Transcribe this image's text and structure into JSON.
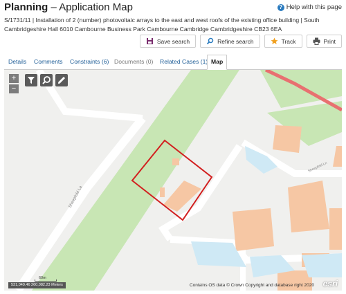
{
  "header": {
    "title_bold": "Planning",
    "title_rest": " – Application Map",
    "help_label": "Help with this page"
  },
  "description": "S/1731/11 | Installation of 2 (number) photovoltaic arrays to the east and west roofs of the existing office building | South Cambridgeshire Hall 6010 Cambourne Business Park Cambourne Cambridge Cambridgeshire CB23 6EA",
  "actions": {
    "save_search": "Save search",
    "refine_search": "Refine search",
    "track": "Track",
    "print": "Print"
  },
  "tabs": [
    {
      "label": "Details"
    },
    {
      "label": "Comments"
    },
    {
      "label": "Constraints (6)"
    },
    {
      "label": "Documents (0)"
    },
    {
      "label": "Related Cases (1)"
    },
    {
      "label": "Map"
    }
  ],
  "map": {
    "zoom_in": "+",
    "zoom_out": "−",
    "coordinates": "531,049.46 260,082.23 Meters",
    "scale_label": "60m",
    "copyright": "Contains OS data © Crown Copyright and database right 2020",
    "esri_logo": "esri",
    "road_labels": [
      "Sheepfold La",
      "Sheepfold Ln"
    ],
    "colors": {
      "boundary": "#d21f1f",
      "buildings": "#f6c7a4",
      "green": "#c8e6b4",
      "water": "#cfe9f5",
      "road_red": "#e87070"
    }
  }
}
